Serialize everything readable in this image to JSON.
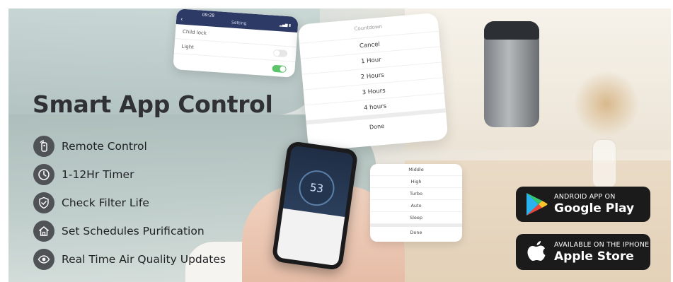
{
  "headline": "Smart App Control",
  "features": [
    {
      "label": "Remote Control",
      "icon": "remote-icon"
    },
    {
      "label": "1-12Hr Timer",
      "icon": "clock-icon"
    },
    {
      "label": "Check Filter Life",
      "icon": "shield-check-icon"
    },
    {
      "label": "Set Schedules Purification",
      "icon": "home-icon"
    },
    {
      "label": "Real Time Air Quality Updates",
      "icon": "eye-icon"
    }
  ],
  "setting_screen": {
    "time": "09:28",
    "title": "Setting",
    "rows": [
      {
        "label": "Child lock",
        "toggle": false
      },
      {
        "label": "Light",
        "toggle": true
      }
    ]
  },
  "countdown": {
    "title": "Countdown",
    "options": [
      "Cancel",
      "1 Hour",
      "2 Hours",
      "3 Hours",
      "4 hours"
    ],
    "done": "Done"
  },
  "modes": {
    "options": [
      "Middle",
      "High",
      "Turbo",
      "Auto",
      "Sleep"
    ],
    "done": "Done"
  },
  "phone": {
    "aqi": "53"
  },
  "badges": {
    "android": {
      "small": "ANDROID APP ON",
      "large": "Google Play"
    },
    "apple": {
      "small": "AVAILABLE ON THE IPHONE",
      "large": "Apple Store"
    }
  },
  "colors": {
    "icon_bg": "#505356",
    "heading": "#2f3133",
    "badge_bg": "#1b1b1b",
    "toggle_on": "#5cc46a",
    "setting_bar": "#2e3a66"
  }
}
